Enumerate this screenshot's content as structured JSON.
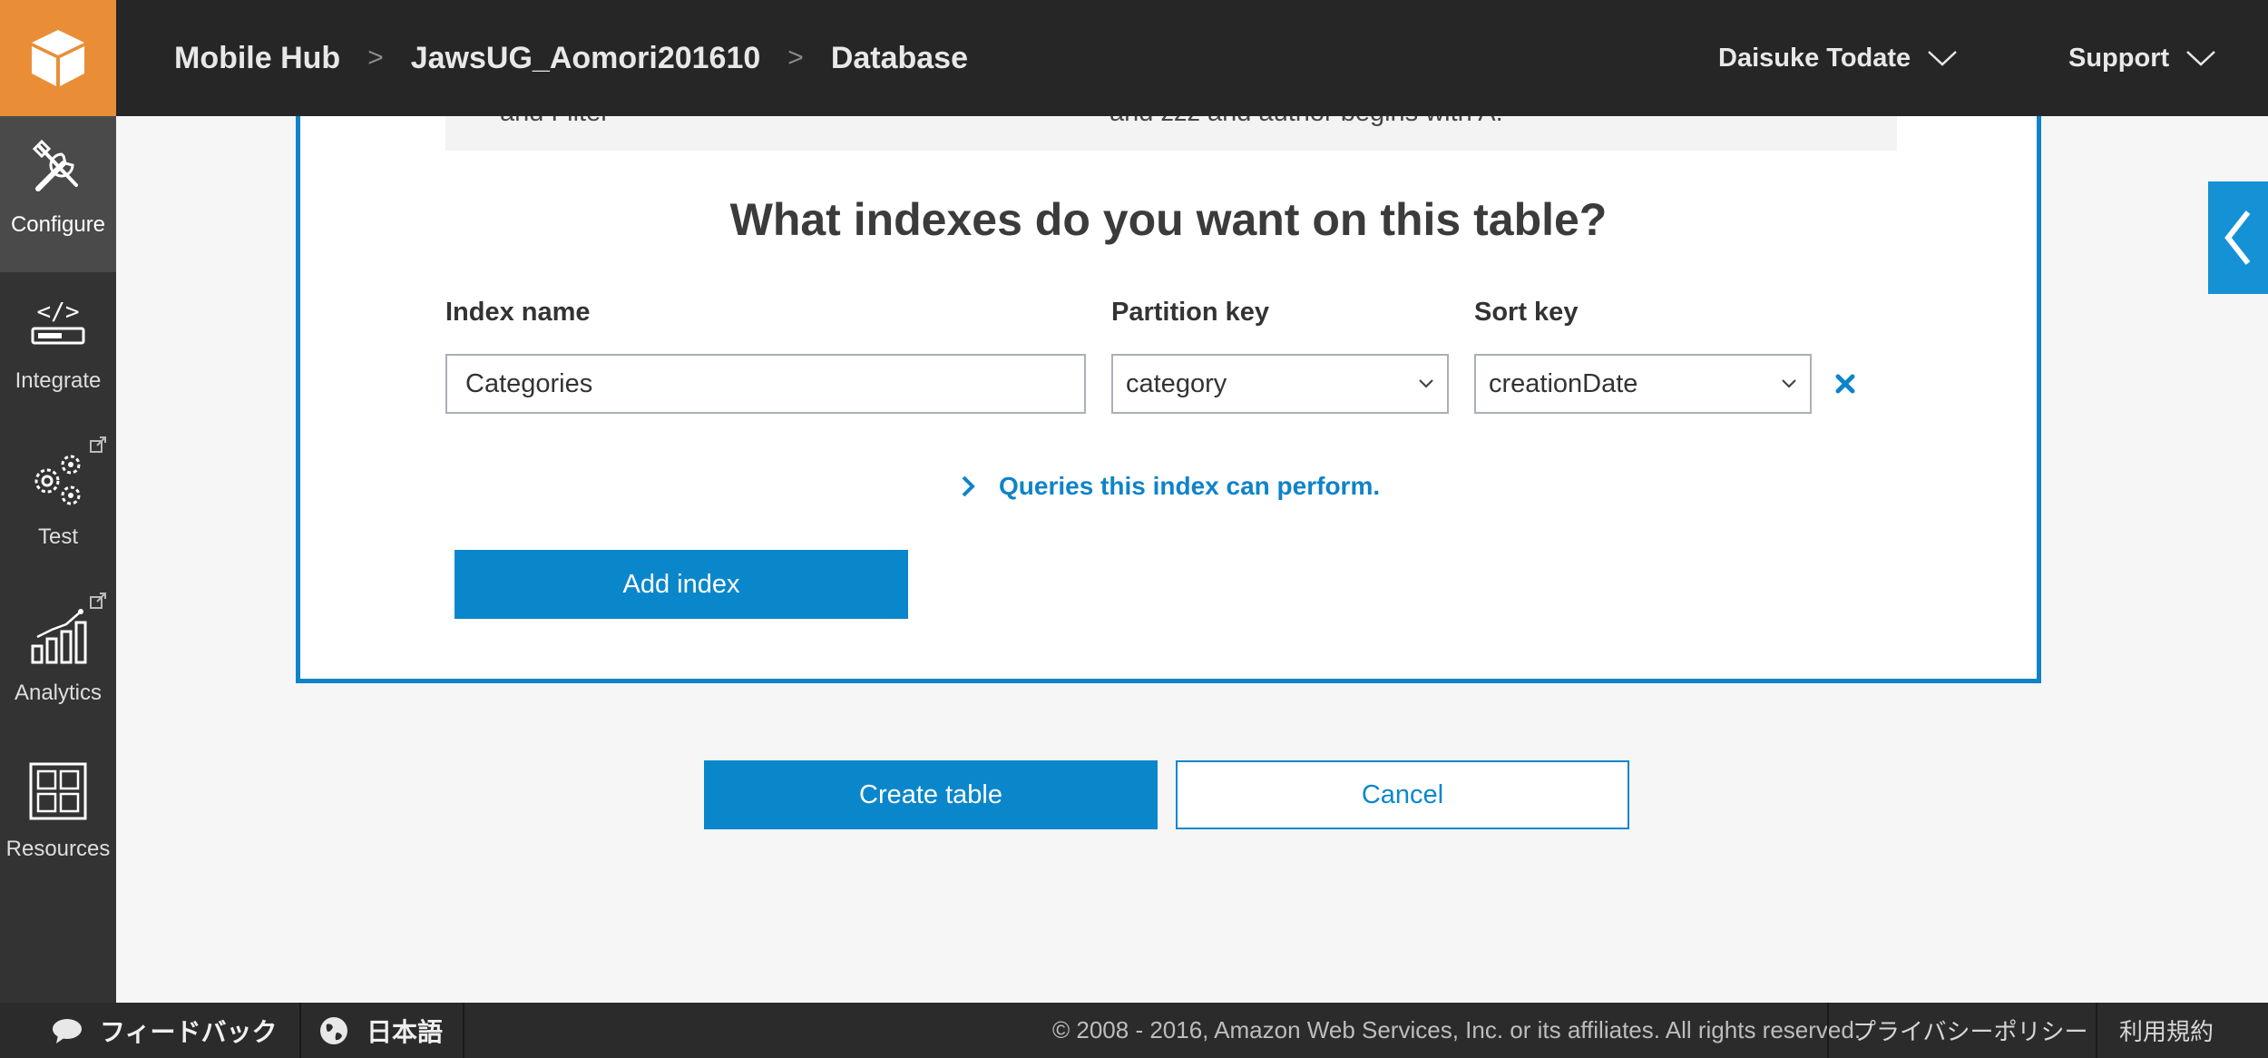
{
  "header": {
    "breadcrumbs": [
      "Mobile Hub",
      "JawsUG_Aomori201610",
      "Database"
    ],
    "user": "Daisuke Todate",
    "support": "Support"
  },
  "sidenav": {
    "items": [
      {
        "label": "Configure",
        "icon": "tools-icon",
        "active": true
      },
      {
        "label": "Integrate",
        "icon": "code-icon"
      },
      {
        "label": "Test",
        "icon": "gears-icon",
        "external": true
      },
      {
        "label": "Analytics",
        "icon": "analytics-chart-icon",
        "external": true
      },
      {
        "label": "Resources",
        "icon": "grid-icon"
      }
    ]
  },
  "previous_row": {
    "left_text": "and Filter",
    "right_text": "and zzz and author begins with A."
  },
  "indexes": {
    "question": "What indexes do you want on this table?",
    "columns": {
      "index_name": "Index name",
      "partition_key": "Partition key",
      "sort_key": "Sort key"
    },
    "row": {
      "index_name_value": "Categories",
      "partition_key_value": "category",
      "sort_key_value": "creationDate"
    },
    "queries_link": "Queries this index can perform.",
    "add_index_label": "Add index"
  },
  "actions": {
    "create_table": "Create table",
    "cancel": "Cancel"
  },
  "footer": {
    "feedback": "フィードバック",
    "language": "日本語",
    "copyright": "© 2008 - 2016, Amazon Web Services, Inc. or its affiliates. All rights reserved.",
    "privacy": "プライバシーポリシー",
    "terms": "利用規約"
  },
  "colors": {
    "accent": "#0a87cb",
    "logo_bg": "#e98e37",
    "topbar_bg": "#262626"
  }
}
